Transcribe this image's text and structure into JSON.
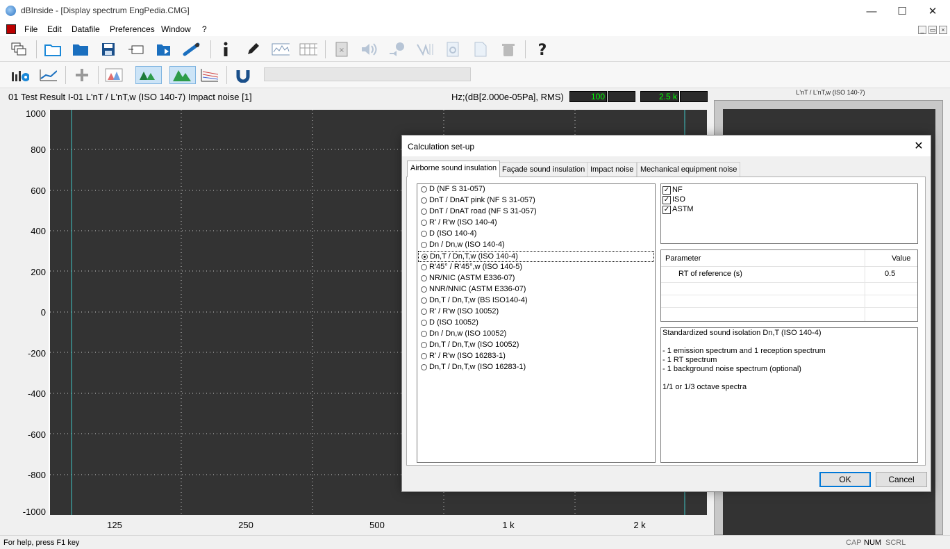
{
  "window": {
    "title": "dBInside - [Display spectrum EngPedia.CMG]"
  },
  "menu": [
    "File",
    "Edit",
    "Datafile",
    "Preferences",
    "Window",
    "?"
  ],
  "graph": {
    "title": "01 Test Result I-01 L'nT / L'nT,w (ISO 140-7) Impact noise [1]",
    "units": "Hz;(dB[2.000e-05Pa], RMS)",
    "freq_low": "100",
    "freq_high": "2.5 k",
    "y_ticks": [
      "1000",
      "800",
      "600",
      "400",
      "200",
      "0",
      "-200",
      "-400",
      "-600",
      "-800",
      "-1000"
    ],
    "x_ticks": [
      "125",
      "250",
      "500",
      "1 k",
      "2 k"
    ]
  },
  "right_panel": {
    "title": "L'nT / L'nT,w (ISO 140-7)"
  },
  "status": {
    "help": "For help, press F1 key",
    "cap": "CAP",
    "num": "NUM",
    "scrl": "SCRL"
  },
  "dialog": {
    "title": "Calculation set-up",
    "tabs": [
      "Airborne sound insulation",
      "Façade sound insulation",
      "Impact noise",
      "Mechanical equipment noise"
    ],
    "active_tab": 0,
    "options": [
      "D (NF S 31-057)",
      "DnT / DnAT pink (NF S 31-057)",
      "DnT / DnAT road (NF S 31-057)",
      "R' / R'w (ISO 140-4)",
      "D (ISO 140-4)",
      "Dn / Dn,w (ISO 140-4)",
      "Dn,T / Dn,T,w (ISO 140-4)",
      "R'45° / R'45°,w (ISO 140-5)",
      "NR/NIC (ASTM E336-07)",
      "NNR/NNIC (ASTM E336-07)",
      "Dn,T / Dn,T,w (BS ISO140-4)",
      "R' / R'w (ISO 10052)",
      "D (ISO 10052)",
      "Dn / Dn,w (ISO 10052)",
      "Dn,T / Dn,T,w (ISO 10052)",
      "R' / R'w (ISO 16283-1)",
      "Dn,T / Dn,T,w (ISO 16283-1)"
    ],
    "selected_option": 6,
    "standards": [
      {
        "label": "NF",
        "checked": true
      },
      {
        "label": "ISO",
        "checked": true
      },
      {
        "label": "ASTM",
        "checked": true
      }
    ],
    "param_table": {
      "headers": [
        "Parameter",
        "Value"
      ],
      "rows": [
        {
          "name": "RT of reference (s)",
          "value": "0.5"
        }
      ]
    },
    "description": [
      "Standardized sound isolation Dn,T (ISO 140-4)",
      "",
      "- 1 emission spectrum and 1 reception spectrum",
      "- 1 RT spectrum",
      "- 1 background noise spectrum (optional)",
      "",
      "1/1 or 1/3 octave spectra"
    ],
    "ok_label": "OK",
    "cancel_label": "Cancel"
  }
}
